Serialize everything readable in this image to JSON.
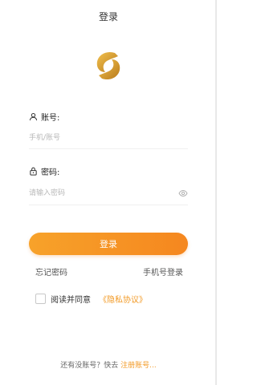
{
  "header": {
    "title": "登录"
  },
  "account": {
    "label": "账号:",
    "placeholder": "手机/账号",
    "icon": "user-icon"
  },
  "password": {
    "label": "密码:",
    "placeholder": "请输入密码",
    "icon": "lock-icon",
    "toggle_icon": "eye-icon"
  },
  "actions": {
    "login_label": "登录",
    "forgot_label": "忘记密码",
    "phone_login_label": "手机号登录"
  },
  "agreement": {
    "text": "阅读并同意",
    "link": "《隐私协议》",
    "checked": false
  },
  "footer": {
    "text": "还有没账号？快去",
    "link": "注册账号..."
  },
  "colors": {
    "accent": "#f5871f",
    "link": "#f29a26"
  }
}
